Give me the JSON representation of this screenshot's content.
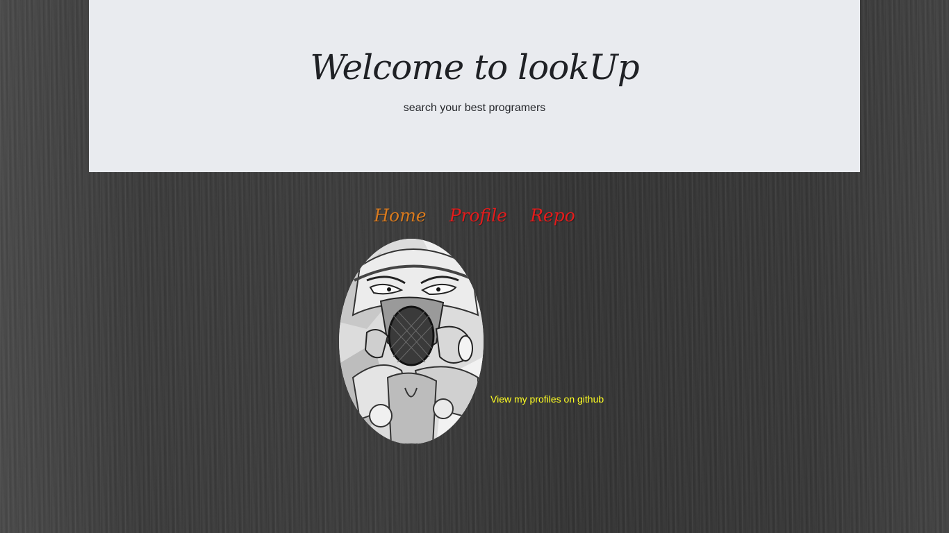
{
  "header": {
    "title": "Welcome to lookUp",
    "subtitle": "search your best programers"
  },
  "nav": {
    "items": [
      {
        "label": "Home",
        "color": "#d97a1e"
      },
      {
        "label": "Profile",
        "color": "#e41b1b"
      },
      {
        "label": "Repo",
        "color": "#e41b1b"
      }
    ]
  },
  "profile": {
    "avatar_icon": "profile-avatar-image",
    "github_link_label": "View my profiles on github",
    "link_color": "#ffff22"
  },
  "colors": {
    "jumbotron_bg": "#e9ebef",
    "page_bg": "#3a3a3a"
  }
}
